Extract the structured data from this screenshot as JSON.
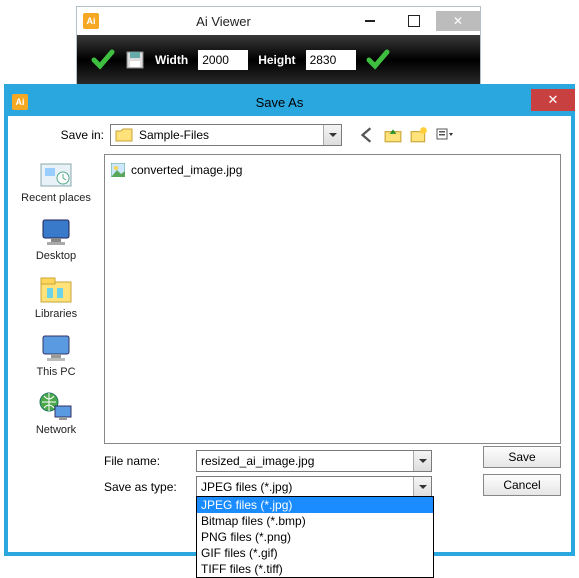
{
  "parent": {
    "title": "Ai Viewer",
    "width_label": "Width",
    "height_label": "Height",
    "width_value": "2000",
    "height_value": "2830"
  },
  "dialog": {
    "title": "Save As",
    "savein_label": "Save in:",
    "savein_value": "Sample-Files",
    "filename_label": "File name:",
    "filename_value": "resized_ai_image.jpg",
    "saveastype_label": "Save as type:",
    "saveastype_value": "JPEG files (*.jpg)",
    "save_btn": "Save",
    "cancel_btn": "Cancel",
    "file_in_list": "converted_image.jpg",
    "sidebar": [
      "Recent places",
      "Desktop",
      "Libraries",
      "This PC",
      "Network"
    ],
    "type_options": [
      "JPEG files (*.jpg)",
      "Bitmap files (*.bmp)",
      "PNG files (*.png)",
      "GIF files (*.gif)",
      "TIFF files (*.tiff)"
    ]
  }
}
